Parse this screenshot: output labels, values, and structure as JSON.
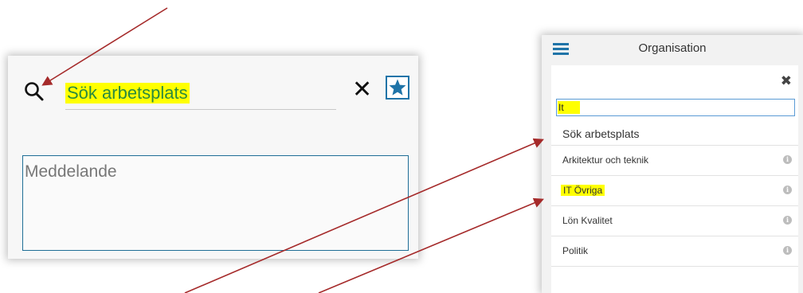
{
  "left_card": {
    "search_placeholder": "Sök arbetsplats",
    "message_placeholder": "Meddelande",
    "icons": {
      "search": "search-icon",
      "close": "close-icon",
      "favorite": "star-icon"
    }
  },
  "right_panel": {
    "title": "Organisation",
    "search_value": "It",
    "section_label": "Sök arbetsplats",
    "items": [
      {
        "label": "Arkitektur och teknik",
        "highlighted": false
      },
      {
        "label": "IT Övriga",
        "highlighted": true
      },
      {
        "label": "Lön Kvalitet",
        "highlighted": false
      },
      {
        "label": "Politik",
        "highlighted": false
      }
    ],
    "icons": {
      "menu": "hamburger-icon",
      "close": "close-icon",
      "info": "info-icon"
    }
  },
  "colors": {
    "highlight": "#ffff00",
    "accent_blue": "#1f74a8",
    "annotation_arrow": "#a52a2a",
    "search_text_green": "#2b8a3e"
  }
}
